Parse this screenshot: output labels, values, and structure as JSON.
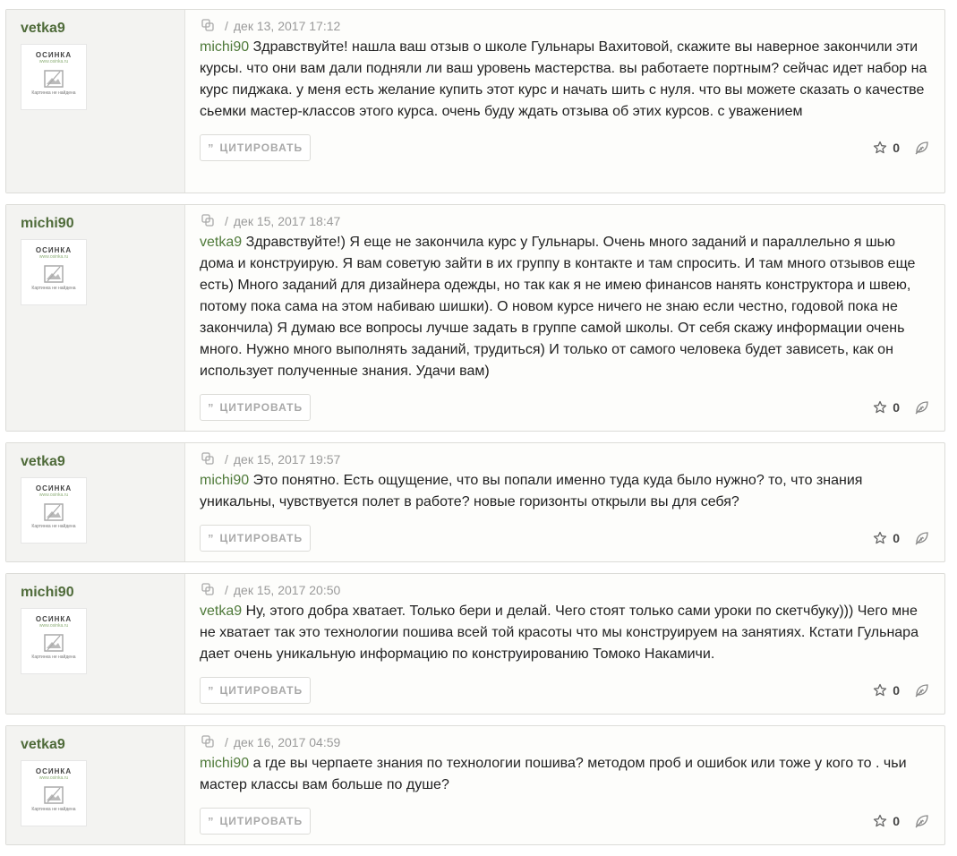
{
  "avatar": {
    "logo": "ОСИНКА",
    "url": "www.osinka.ru",
    "text": "Картинка не найдена"
  },
  "quote_label": "ЦИТИРОВАТЬ",
  "posts": [
    {
      "author": "vetka9",
      "date": "дек 13, 2017 17:12",
      "mention": "michi90",
      "text": " Здравствуйте! нашла ваш отзыв о школе Гульнары Вахитовой, скажите вы наверное закончили эти курсы. что они вам дали подняли ли ваш уровень мастерства. вы работаете портным? сейчас идет набор на курс пиджака. у меня есть желание купить этот курс и начать шить с нуля. что вы можете сказать о качестве сьемки мастер-классов этого курса. очень буду ждать отзыва об этих курсов. с уважением",
      "likes": "0"
    },
    {
      "author": "michi90",
      "date": "дек 15, 2017 18:47",
      "mention": "vetka9",
      "text": " Здравствуйте!) Я еще не закончила курс у Гульнары. Очень много заданий и параллельно я шью дома и конструирую. Я вам советую зайти в их группу в контакте и там спросить. И там много отзывов еще есть) Много заданий для дизайнера одежды, но так как я не имею финансов нанять конструктора и швею, потому пока сама на этом набиваю шишки). О новом курсе ничего не знаю если честно, годовой пока не закончила) Я думаю все вопросы лучше задать в группе самой школы. От себя скажу информации очень много. Нужно много выполнять заданий, трудиться) И только от самого человека будет зависеть, как он использует полученные знания. Удачи вам)",
      "likes": "0"
    },
    {
      "author": "vetka9",
      "date": "дек 15, 2017 19:57",
      "mention": "michi90",
      "text": " Это понятно. Есть ощущение, что вы попали именно туда куда было нужно? то, что знания уникальны, чувствуется полет в работе? новые горизонты открыли вы для себя?",
      "likes": "0"
    },
    {
      "author": "michi90",
      "date": "дек 15, 2017 20:50",
      "mention": "vetka9",
      "text": " Ну, этого добра хватает. Только бери и делай. Чего стоят только сами уроки по скетчбуку))) Чего мне не хватает так это технологии пошива всей той красоты что мы конструируем на занятиях. Кстати Гульнара дает очень уникальную информацию по конструированию Томоко Накамичи.",
      "likes": "0"
    },
    {
      "author": "vetka9",
      "date": "дек 16, 2017 04:59",
      "mention": "michi90",
      "text": " а где вы черпаете знания по технологии пошива? методом проб и ошибок или тоже у кого то . чьи мастер классы вам больше по душе?",
      "likes": "0"
    }
  ],
  "icons": {
    "copy": "copy-link-icon",
    "star": "star-icon",
    "leaf": "leaf-icon",
    "quote": "quote-icon"
  },
  "colors": {
    "author": "#4f6b3a",
    "mention": "#4f7a3a"
  }
}
